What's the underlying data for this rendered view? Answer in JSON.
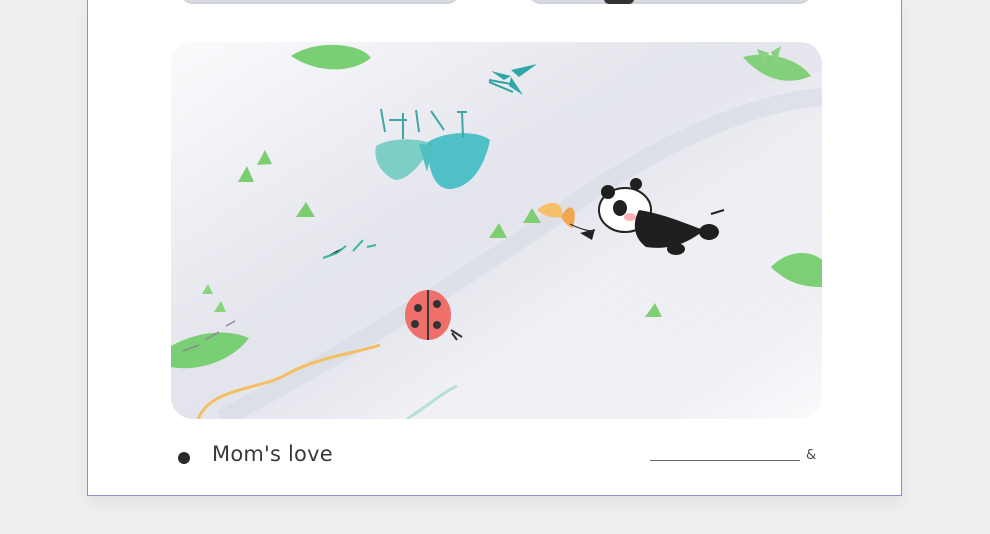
{
  "caption": {
    "text": "Mom's love",
    "symbol": "&"
  }
}
